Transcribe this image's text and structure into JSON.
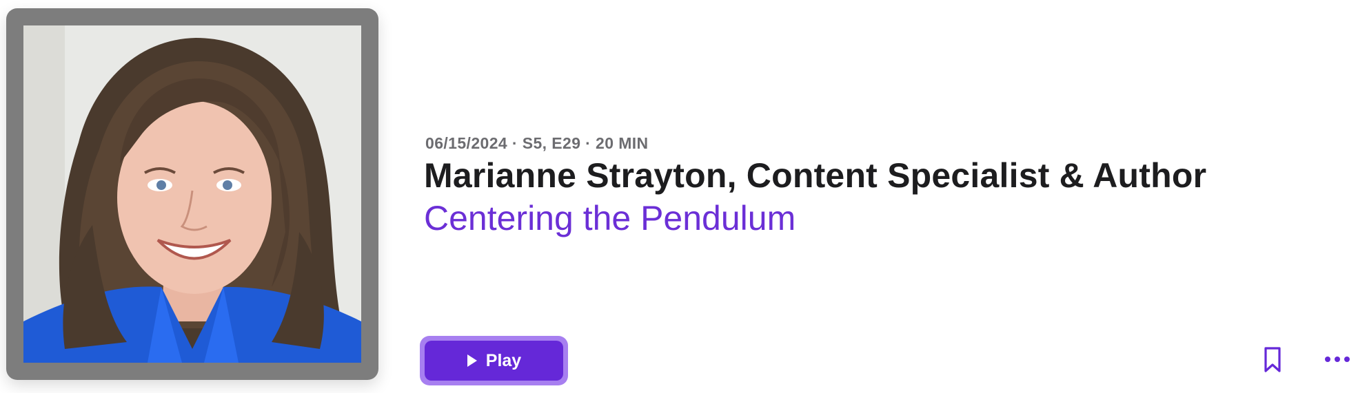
{
  "episode": {
    "meta": "06/15/2024 · S5, E29 · 20 MIN",
    "title": "Marianne Strayton, Content Specialist & Author",
    "show_name": "Centering the Pendulum",
    "artwork_alt": "photo"
  },
  "actions": {
    "play_label": "Play",
    "play_icon": "play-icon",
    "bookmark_icon": "bookmark-icon",
    "more_icon": "more-icon"
  },
  "colors": {
    "accent": "#6528d8",
    "accent_outline": "#a77ff0",
    "show_link": "#6b2fd6",
    "meta_text": "#6c6c70",
    "title_text": "#1d1d1f",
    "artwork_frame": "#7d7d7d"
  }
}
